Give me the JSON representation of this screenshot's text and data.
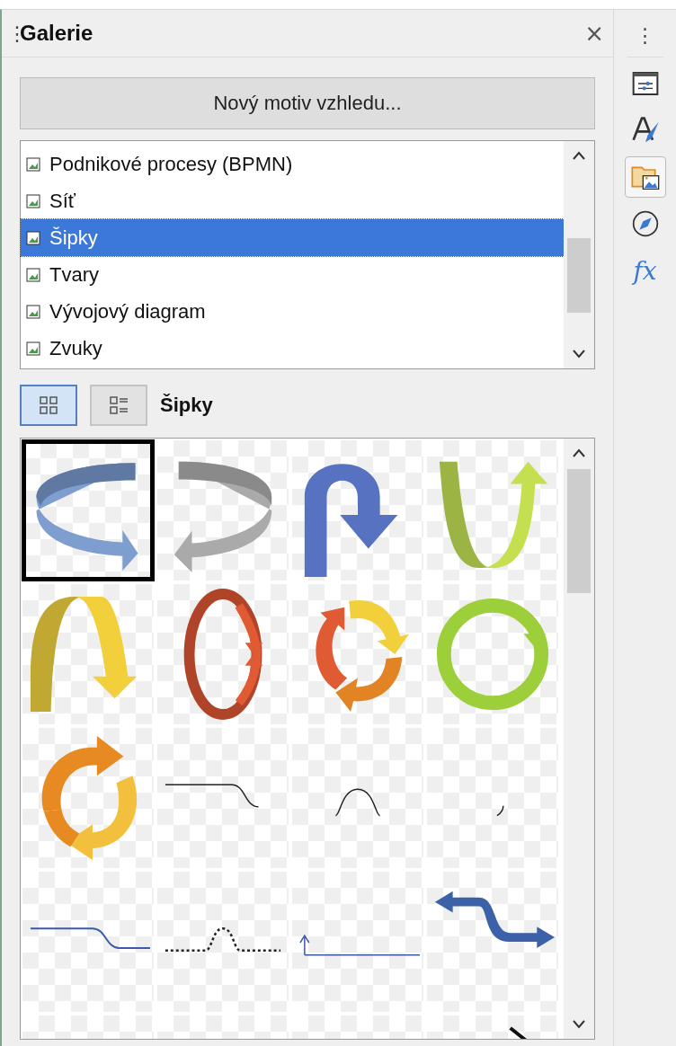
{
  "panel": {
    "title": "Galerie",
    "close": "×",
    "grip": "⋮"
  },
  "new_theme_button": "Nový motiv vzhledu...",
  "themes": [
    {
      "label": "Podnikové procesy (BPMN)",
      "selected": false
    },
    {
      "label": "Síť",
      "selected": false
    },
    {
      "label": "Šipky",
      "selected": true
    },
    {
      "label": "Tvary",
      "selected": false
    },
    {
      "label": "Vývojový diagram",
      "selected": false
    },
    {
      "label": "Zvuky",
      "selected": false
    }
  ],
  "view_buttons": [
    {
      "kind": "icons",
      "selected": true
    },
    {
      "kind": "details",
      "selected": false
    }
  ],
  "current_theme": "Šipky",
  "gallery": [
    {
      "kind": "swirl-right",
      "selected": true
    },
    {
      "kind": "swirl-left",
      "selected": false
    },
    {
      "kind": "u-turn",
      "selected": false
    },
    {
      "kind": "v-up",
      "selected": false
    },
    {
      "kind": "arch-down",
      "selected": false
    },
    {
      "kind": "ellipse",
      "selected": false
    },
    {
      "kind": "cycle",
      "selected": false
    },
    {
      "kind": "ring",
      "selected": false
    },
    {
      "kind": "cycle-orange",
      "selected": false
    },
    {
      "kind": "line-step",
      "selected": false
    },
    {
      "kind": "line-bump",
      "selected": false
    },
    {
      "kind": "line-tick",
      "selected": false
    },
    {
      "kind": "line-step-blue",
      "selected": false
    },
    {
      "kind": "dotted-bump",
      "selected": false
    },
    {
      "kind": "line-hook",
      "selected": false
    },
    {
      "kind": "zigzag-arrow",
      "selected": false
    },
    {
      "kind": "empty",
      "selected": false
    },
    {
      "kind": "empty",
      "selected": false
    },
    {
      "kind": "empty",
      "selected": false
    },
    {
      "kind": "diagonal-line",
      "selected": false
    }
  ],
  "sidebar": {
    "menu": "⋮",
    "tabs": [
      {
        "kind": "properties",
        "selected": false
      },
      {
        "kind": "styles",
        "selected": false
      },
      {
        "kind": "gallery",
        "selected": true
      },
      {
        "kind": "navigator",
        "selected": false
      },
      {
        "kind": "functions",
        "label": "fx",
        "selected": false
      }
    ]
  }
}
